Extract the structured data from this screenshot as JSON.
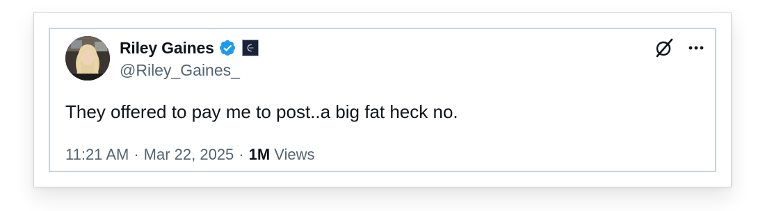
{
  "tweet": {
    "author": {
      "display_name": "Riley Gaines",
      "handle": "@Riley_Gaines_",
      "verified": true,
      "avatar_icon": "profile-photo"
    },
    "text": "They offered to pay me to post..a big fat heck no.",
    "time": "11:21 AM",
    "date": "Mar 22, 2025",
    "views_count": "1M",
    "views_label": "Views",
    "separator": "·"
  },
  "colors": {
    "verified_blue": "#1d9bf0",
    "text_primary": "#0f1419",
    "text_secondary": "#536471"
  },
  "icons": {
    "grok": "grok-icon",
    "more": "more-icon"
  }
}
